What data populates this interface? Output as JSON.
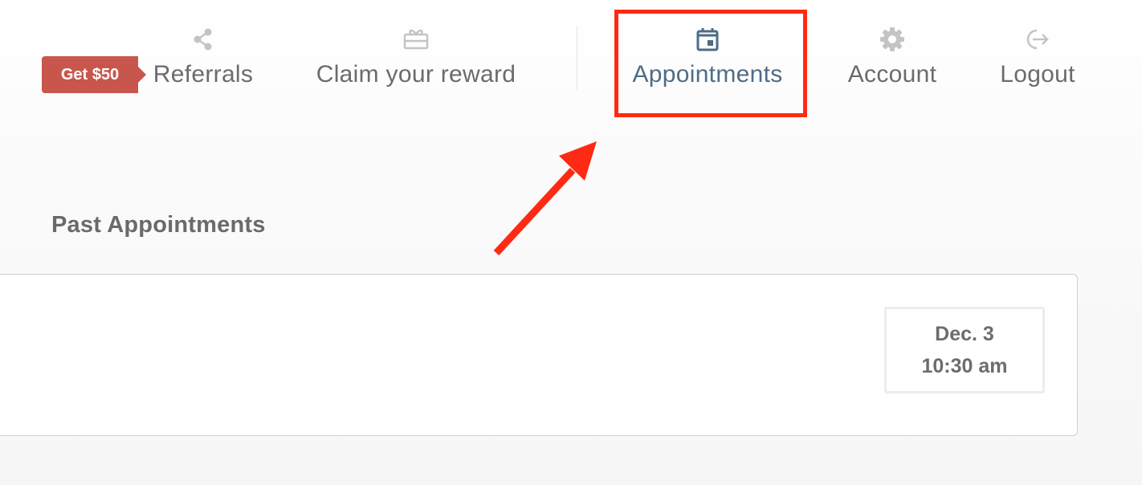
{
  "promo": {
    "label": "Get $50"
  },
  "nav": {
    "referrals": {
      "label": "Referrals",
      "icon": "share-icon"
    },
    "claim": {
      "label": "Claim your reward",
      "icon": "gift-icon"
    },
    "appointments": {
      "label": "Appointments",
      "icon": "calendar-icon",
      "active": true
    },
    "account": {
      "label": "Account",
      "icon": "gear-icon"
    },
    "logout": {
      "label": "Logout",
      "icon": "logout-icon"
    }
  },
  "main": {
    "section_title": "Past Appointments",
    "appointments": [
      {
        "date": "Dec. 3",
        "time": "10:30 am"
      }
    ]
  },
  "colors": {
    "promo_badge": "#c9564d",
    "active_nav": "#4f6c85",
    "annotation": "#fe2a14",
    "icon_gray": "#c4c4c4"
  }
}
